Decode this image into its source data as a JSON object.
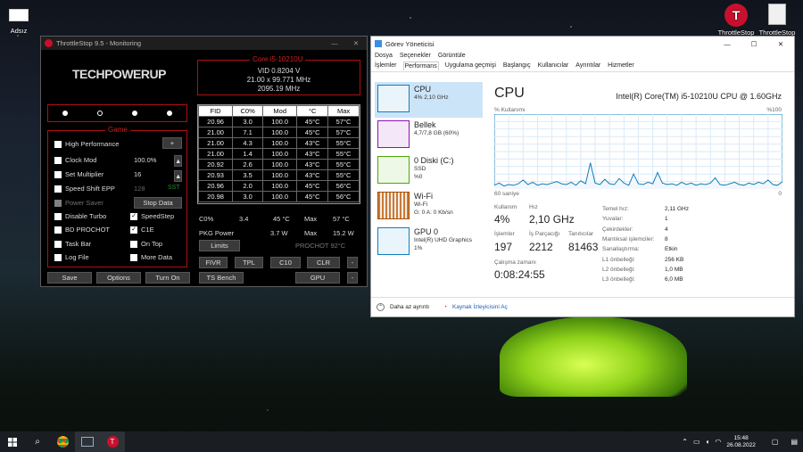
{
  "desktop": {
    "icon1": "Adsız",
    "icon2": "ThrottleStop",
    "icon3": "ThrottleStop"
  },
  "ts": {
    "title": "ThrottleStop 9.5 - Monitoring",
    "brand": "TECHPOWERUP",
    "cpu_name": "Core i5-10210U",
    "vid": "VID  0.8204 V",
    "freq1": "21.00 x 99.771 MHz",
    "freq2": "2095.19 MHz",
    "game_title": "Game",
    "options": [
      {
        "label": "High Performance",
        "checked": false
      },
      {
        "label": "Clock Mod",
        "checked": false,
        "value": "100.0%"
      },
      {
        "label": "Set Multiplier",
        "checked": false,
        "value": "16"
      },
      {
        "label": "Speed Shift EPP",
        "checked": false,
        "value": "128",
        "extra": "SST"
      },
      {
        "label": "Power Saver",
        "checked": false
      },
      {
        "label": "Disable Turbo",
        "checked": false
      },
      {
        "label": "BD PROCHOT",
        "checked": false
      },
      {
        "label": "Task Bar",
        "checked": false
      },
      {
        "label": "Log File",
        "checked": false
      }
    ],
    "opts_right": [
      {
        "label": "SpeedStep",
        "checked": true
      },
      {
        "label": "C1E",
        "checked": true
      },
      {
        "label": "On Top",
        "checked": false
      },
      {
        "label": "More Data",
        "checked": false
      }
    ],
    "plus": "+",
    "stop_data": "Stop Data",
    "table_headers": [
      "FID",
      "C0%",
      "Mod",
      "°C",
      "Max"
    ],
    "rows": [
      [
        "20.96",
        "3.0",
        "100.0",
        "45°C",
        "57°C"
      ],
      [
        "21.00",
        "7.1",
        "100.0",
        "45°C",
        "57°C"
      ],
      [
        "21.00",
        "4.3",
        "100.0",
        "43°C",
        "55°C"
      ],
      [
        "21.00",
        "1.4",
        "100.0",
        "43°C",
        "55°C"
      ],
      [
        "20.92",
        "2.6",
        "100.0",
        "43°C",
        "55°C"
      ],
      [
        "20.93",
        "3.5",
        "100.0",
        "43°C",
        "55°C"
      ],
      [
        "20.96",
        "2.0",
        "100.0",
        "45°C",
        "56°C"
      ],
      [
        "20.98",
        "3.0",
        "100.0",
        "45°C",
        "56°C"
      ]
    ],
    "sum_c0_label": "C0%",
    "sum_c0": "3.4",
    "sum_temp": "45 °C",
    "sum_max_label": "Max",
    "sum_max": "57 °C",
    "pkg_label": "PKG Power",
    "pkg": "3.7 W",
    "pkg_max_label": "Max",
    "pkg_max": "15.2 W",
    "limits": "Limits",
    "prochot": "PROCHOT 92°C",
    "btns": [
      "FIVR",
      "TPL",
      "C10",
      "CLR",
      "-"
    ],
    "bottom": [
      "Save",
      "Options",
      "Turn On",
      "TS Bench",
      "GPU",
      "-"
    ]
  },
  "tm": {
    "title": "Görev Yöneticisi",
    "menu": [
      "Dosya",
      "Seçenekler",
      "Görüntüle"
    ],
    "tabs": [
      "İşlemler",
      "Performans",
      "Uygulama geçmişi",
      "Başlangıç",
      "Kullanıcılar",
      "Ayrıntılar",
      "Hizmetler"
    ],
    "side": [
      {
        "name": "CPU",
        "sub1": "4% 2,10 GHz",
        "sub2": ""
      },
      {
        "name": "Bellek",
        "sub1": "4,7/7,8 GB (60%)",
        "sub2": ""
      },
      {
        "name": "0 Diski (C:)",
        "sub1": "SSD",
        "sub2": "%0"
      },
      {
        "name": "Wi-Fi",
        "sub1": "Wi-Fi",
        "sub2": "G: 0 A: 0 Kb/sn"
      },
      {
        "name": "GPU 0",
        "sub1": "Intel(R) UHD Graphics",
        "sub2": "1%"
      }
    ],
    "cpu_title": "CPU",
    "cpu_model": "Intel(R) Core(TM) i5-10210U CPU @ 1.60GHz",
    "usage_label": "% Kullanımı",
    "usage_max": "%100",
    "time_left": "60 saniye",
    "time_right": "0",
    "kullanim_label": "Kullanım",
    "kullanim": "4%",
    "hiz_label": "Hız",
    "hiz": "2,10 GHz",
    "islem_label": "İşlemler",
    "islem": "197",
    "parca_label": "İş Parçacığı",
    "parca": "2212",
    "tanit_label": "Tanıtıcılar",
    "tanit": "81463",
    "uptime_label": "Çalışma zamanı",
    "uptime": "0:08:24:55",
    "specs": [
      [
        "Temel hız:",
        "2,11 GHz"
      ],
      [
        "Yuvalar:",
        "1"
      ],
      [
        "Çekirdekler:",
        "4"
      ],
      [
        "Mantıksal işlemciler:",
        "8"
      ],
      [
        "Sanallaştırma:",
        "Etkin"
      ],
      [
        "L1 önbelleği:",
        "256 KB"
      ],
      [
        "L2 önbelleği:",
        "1,0 MB"
      ],
      [
        "L3 önbelleği:",
        "6,0 MB"
      ]
    ],
    "less": "Daha az ayrıntı",
    "monitor": "Kaynak İzleyicisini Aç",
    "graph": [
      0.05,
      0.08,
      0.04,
      0.06,
      0.05,
      0.07,
      0.12,
      0.06,
      0.09,
      0.05,
      0.07,
      0.06,
      0.08,
      0.1,
      0.07,
      0.06,
      0.09,
      0.05,
      0.11,
      0.07,
      0.35,
      0.08,
      0.06,
      0.13,
      0.07,
      0.06,
      0.14,
      0.08,
      0.05,
      0.2,
      0.07,
      0.06,
      0.09,
      0.07,
      0.22,
      0.08,
      0.06,
      0.07,
      0.05,
      0.09,
      0.06,
      0.08,
      0.05,
      0.07,
      0.06,
      0.08,
      0.15,
      0.06,
      0.05,
      0.07,
      0.09,
      0.06,
      0.05,
      0.08,
      0.06,
      0.09,
      0.07,
      0.12,
      0.06,
      0.05,
      0.1
    ]
  },
  "taskbar": {
    "time": "15:48",
    "date": "26.08.2022"
  },
  "colors": {
    "ts_red": "#b01010",
    "tm_accent": "#117dbb",
    "tent": "#a6e02a"
  }
}
